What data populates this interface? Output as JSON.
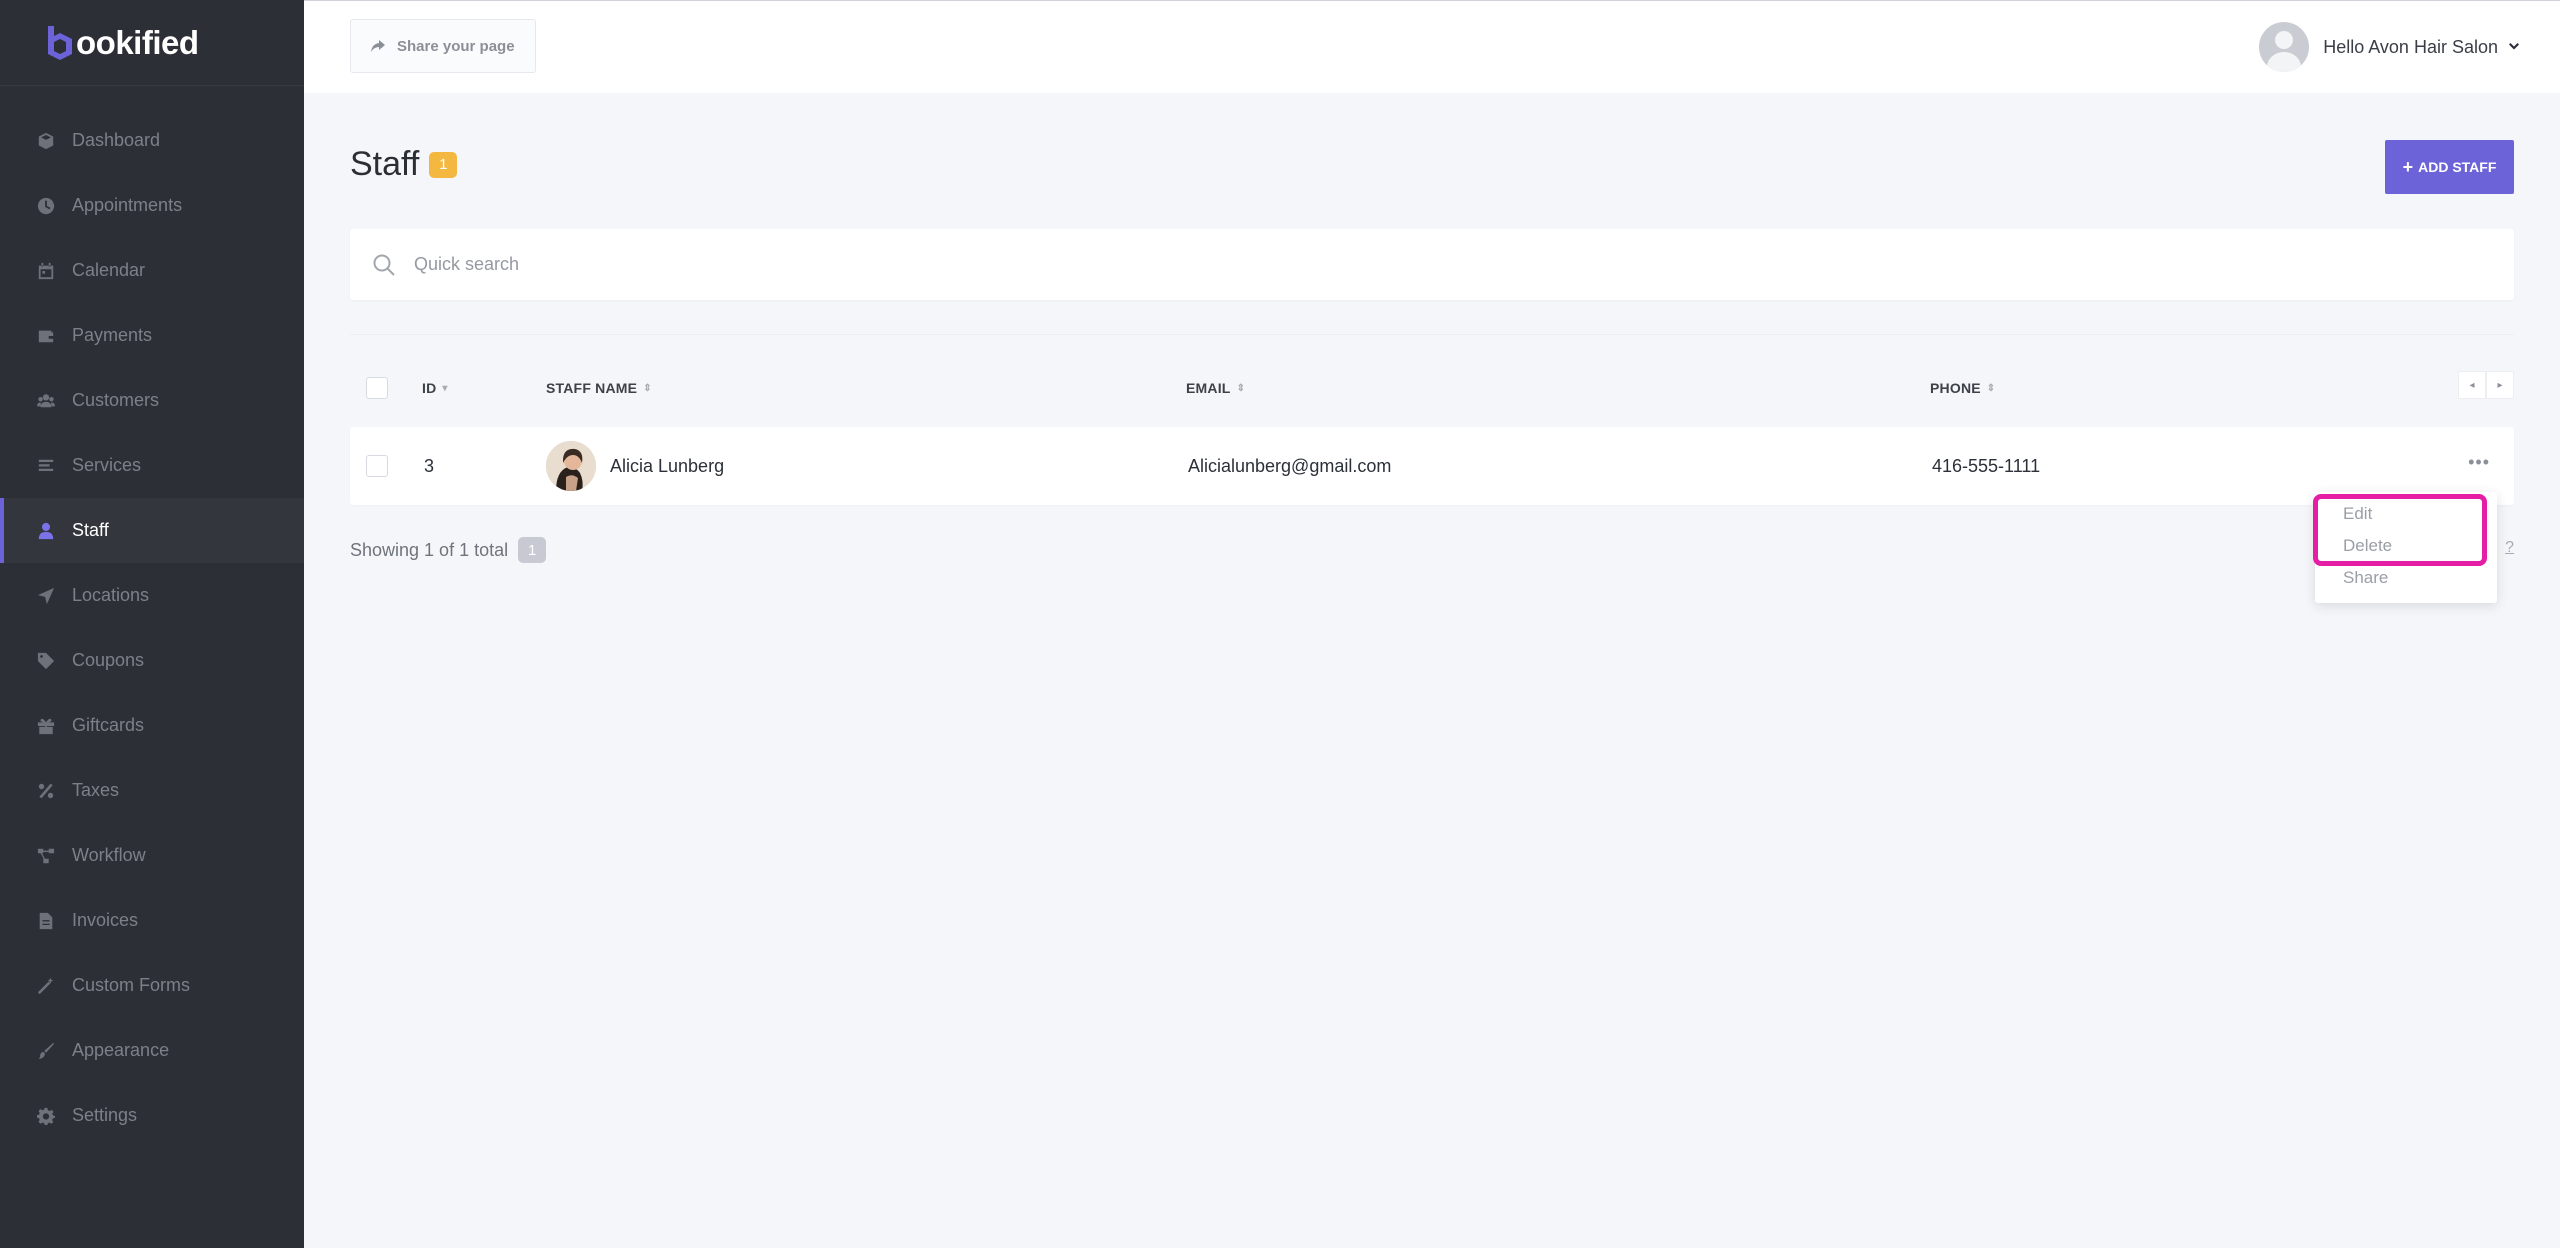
{
  "brand": {
    "logo_text": "ookified"
  },
  "sidebar": {
    "items": [
      {
        "label": "Dashboard",
        "icon": "cube-icon"
      },
      {
        "label": "Appointments",
        "icon": "clock-icon"
      },
      {
        "label": "Calendar",
        "icon": "calendar-icon"
      },
      {
        "label": "Payments",
        "icon": "wallet-icon"
      },
      {
        "label": "Customers",
        "icon": "users-icon"
      },
      {
        "label": "Services",
        "icon": "list-icon"
      },
      {
        "label": "Staff",
        "icon": "user-icon",
        "active": true
      },
      {
        "label": "Locations",
        "icon": "location-arrow-icon"
      },
      {
        "label": "Coupons",
        "icon": "tag-icon"
      },
      {
        "label": "Giftcards",
        "icon": "gift-icon"
      },
      {
        "label": "Taxes",
        "icon": "percent-icon"
      },
      {
        "label": "Workflow",
        "icon": "workflow-icon"
      },
      {
        "label": "Invoices",
        "icon": "file-icon"
      },
      {
        "label": "Custom Forms",
        "icon": "magic-wand-icon"
      },
      {
        "label": "Appearance",
        "icon": "brush-icon"
      },
      {
        "label": "Settings",
        "icon": "gear-icon"
      }
    ]
  },
  "topbar": {
    "share_label": "Share your page",
    "user_greeting": "Hello Avon Hair Salon"
  },
  "page": {
    "title": "Staff",
    "count": "1",
    "add_button": "ADD STAFF"
  },
  "search": {
    "placeholder": "Quick search"
  },
  "table": {
    "columns": {
      "id": "ID",
      "name": "STAFF NAME",
      "email": "EMAIL",
      "phone": "PHONE"
    },
    "rows": [
      {
        "id": "3",
        "name": "Alicia Lunberg",
        "email": "Alicialunberg@gmail.com",
        "phone": "416-555-1111"
      }
    ]
  },
  "footer": {
    "showing": "Showing 1 of 1 total",
    "page": "1",
    "stray": "?"
  },
  "row_menu": {
    "items": [
      "Edit",
      "Delete",
      "Share"
    ]
  },
  "colors": {
    "accent": "#6c63d9",
    "badge": "#f4b740",
    "highlight": "#e61ea6",
    "sidebar_bg": "#2c2f35"
  }
}
